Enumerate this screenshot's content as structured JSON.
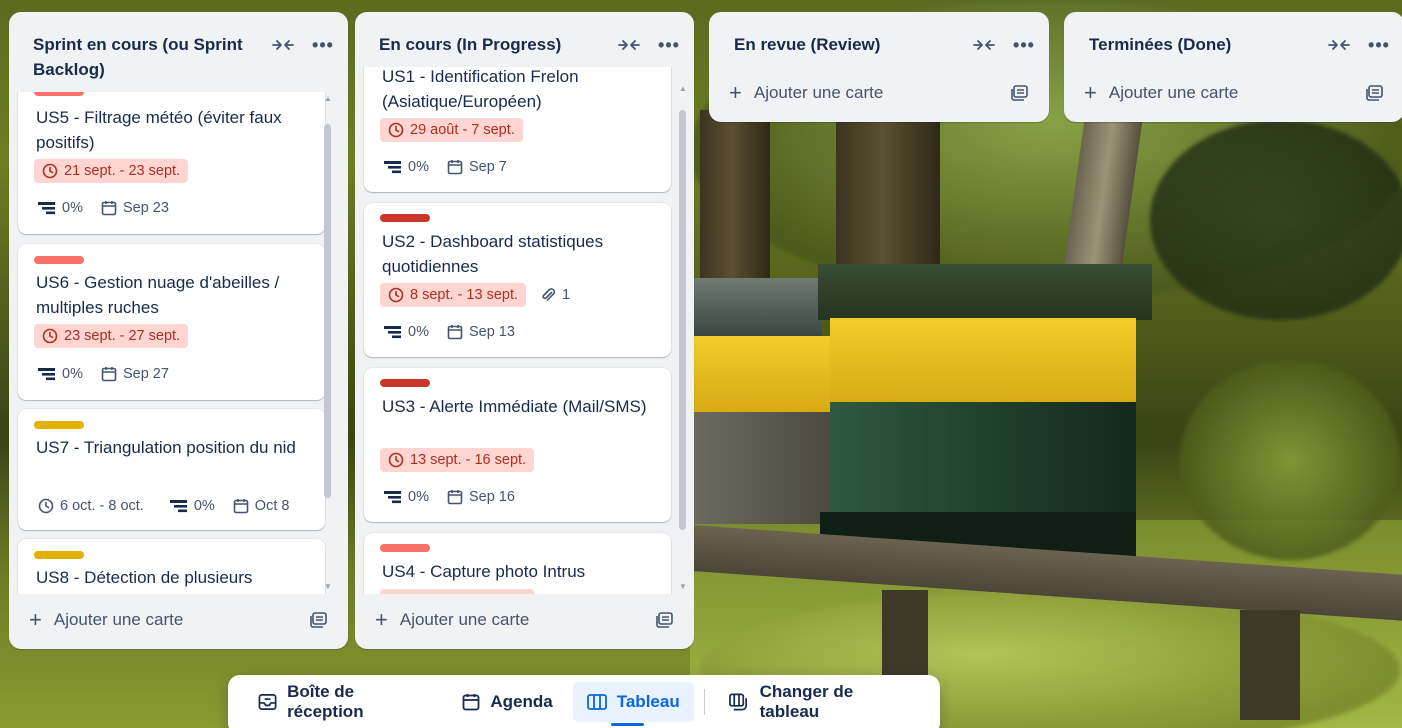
{
  "colors": {
    "label_coral": "#f87168",
    "label_red": "#c9372c",
    "label_yellow": "#e2b203",
    "overdue_bg": "#ffd5d2",
    "overdue_text": "#ae2e24",
    "accent_blue": "#0c66e4"
  },
  "icons": {
    "collapse": "collapse-arrows-icon",
    "more": "more-dots-icon",
    "clock": "clock-icon",
    "checklist": "checklist-bars-icon",
    "calendar": "calendar-icon",
    "attachment": "paperclip-icon",
    "template": "card-template-icon",
    "plus": "plus-icon"
  },
  "lists": [
    {
      "title": "Sprint en cours (ou Sprint Backlog)",
      "add_label": "Ajouter une carte",
      "cards": [
        {
          "label_color": "coral",
          "title": "US5 - Filtrage météo (éviter faux positifs)",
          "dates": "21 sept. - 23 sept.",
          "overdue": true,
          "progress": "0%",
          "due": "Sep 23"
        },
        {
          "label_color": "coral",
          "title": "US6 - Gestion nuage d'abeilles / multiples ruches",
          "dates": "23 sept. - 27 sept.",
          "overdue": true,
          "progress": "0%",
          "due": "Sep 27"
        },
        {
          "label_color": "yellow",
          "title": "US7 - Triangulation position du nid",
          "dates": "6 oct. - 8 oct.",
          "overdue": false,
          "progress": "0%",
          "due": "Oct 8"
        },
        {
          "label_color": "yellow",
          "title": "US8 - Détection de plusieurs"
        }
      ]
    },
    {
      "title": "En cours (In Progress)",
      "add_label": "Ajouter une carte",
      "cards": [
        {
          "title": "US1 - Identification Frelon (Asiatique/Européen)",
          "dates": "29 août - 7 sept.",
          "overdue": true,
          "progress": "0%",
          "due": "Sep 7"
        },
        {
          "label_color": "red",
          "title": "US2 - Dashboard statistiques quotidiennes",
          "dates": "8 sept. - 13 sept.",
          "overdue": true,
          "attachments": "1",
          "progress": "0%",
          "due": "Sep 13"
        },
        {
          "label_color": "red",
          "title": "US3 - Alerte Immédiate (Mail/SMS)",
          "dates": "13 sept. - 16 sept.",
          "overdue": true,
          "progress": "0%",
          "due": "Sep 16"
        },
        {
          "label_color": "coral",
          "title": "US4 - Capture photo Intrus"
        }
      ]
    },
    {
      "title": "En revue (Review)",
      "add_label": "Ajouter une carte",
      "cards": []
    },
    {
      "title": "Terminées (Done)",
      "add_label": "Ajouter une carte",
      "cards": []
    }
  ],
  "bottom_nav": {
    "inbox": "Boîte de réception",
    "agenda": "Agenda",
    "board": "Tableau",
    "switch_board": "Changer de tableau",
    "active": "Tableau"
  }
}
